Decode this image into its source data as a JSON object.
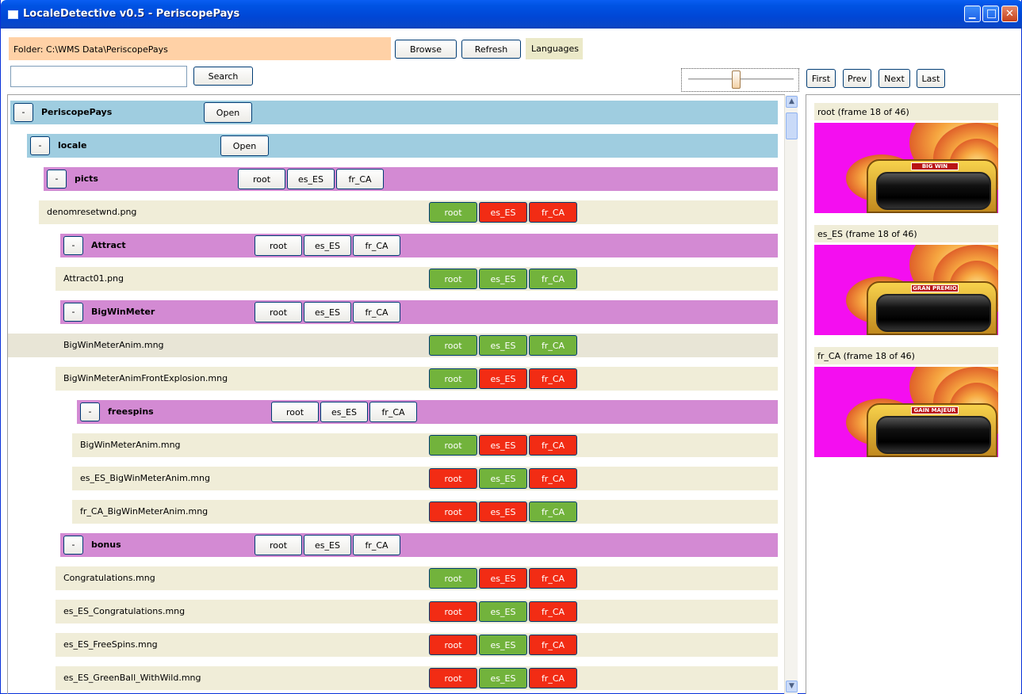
{
  "window": {
    "title": "LocaleDetective v0.5 - PeriscopePays",
    "min_glyph": "▁",
    "max_glyph": "□",
    "close_glyph": "✕"
  },
  "toolbar": {
    "folder_label": "Folder: C:\\WMS Data\\PeriscopePays",
    "browse": "Browse",
    "refresh": "Refresh",
    "languages": "Languages",
    "search_value": "",
    "search_button": "Search",
    "nav": {
      "first": "First",
      "prev": "Prev",
      "next": "Next",
      "last": "Last"
    }
  },
  "tree": {
    "open_label": "Open",
    "toggle_label": "-",
    "rows": [
      {
        "type": "folder",
        "color": "blue",
        "indent": 0,
        "label": "PeriscopePays",
        "action": "open"
      },
      {
        "type": "folder",
        "color": "blue",
        "indent": 1,
        "label": "locale",
        "action": "open"
      },
      {
        "type": "folder",
        "color": "purple",
        "indent": 2,
        "label": "picts",
        "langs": [
          "root",
          "es_ES",
          "fr_CA"
        ]
      },
      {
        "type": "file",
        "indent": 2,
        "label": "denomresetwnd.png",
        "status": {
          "root": "green",
          "es_ES": "red",
          "fr_CA": "red"
        }
      },
      {
        "type": "folder",
        "color": "purple",
        "indent": 3,
        "label": "Attract",
        "langs": [
          "root",
          "es_ES",
          "fr_CA"
        ]
      },
      {
        "type": "file",
        "indent": 3,
        "label": "Attract01.png",
        "status": {
          "root": "green",
          "es_ES": "green",
          "fr_CA": "green"
        }
      },
      {
        "type": "folder",
        "color": "purple",
        "indent": 3,
        "label": "BigWinMeter",
        "langs": [
          "root",
          "es_ES",
          "fr_CA"
        ]
      },
      {
        "type": "file",
        "indent": 3,
        "label": "BigWinMeterAnim.mng",
        "selected": true,
        "status": {
          "root": "green",
          "es_ES": "green",
          "fr_CA": "green"
        }
      },
      {
        "type": "file",
        "indent": 3,
        "label": "BigWinMeterAnimFrontExplosion.mng",
        "status": {
          "root": "green",
          "es_ES": "red",
          "fr_CA": "red"
        }
      },
      {
        "type": "folder",
        "color": "purple",
        "indent": 4,
        "label": "freespins",
        "langs": [
          "root",
          "es_ES",
          "fr_CA"
        ]
      },
      {
        "type": "file",
        "indent": 4,
        "label": "BigWinMeterAnim.mng",
        "status": {
          "root": "green",
          "es_ES": "red",
          "fr_CA": "red"
        }
      },
      {
        "type": "file",
        "indent": 4,
        "label": "es_ES_BigWinMeterAnim.mng",
        "status": {
          "root": "red",
          "es_ES": "green",
          "fr_CA": "red"
        }
      },
      {
        "type": "file",
        "indent": 4,
        "label": "fr_CA_BigWinMeterAnim.mng",
        "status": {
          "root": "red",
          "es_ES": "red",
          "fr_CA": "green"
        }
      },
      {
        "type": "folder",
        "color": "purple",
        "indent": 3,
        "label": "bonus",
        "langs": [
          "root",
          "es_ES",
          "fr_CA"
        ]
      },
      {
        "type": "file",
        "indent": 3,
        "label": "Congratulations.mng",
        "status": {
          "root": "green",
          "es_ES": "red",
          "fr_CA": "red"
        }
      },
      {
        "type": "file",
        "indent": 3,
        "label": "es_ES_Congratulations.mng",
        "status": {
          "root": "red",
          "es_ES": "green",
          "fr_CA": "red"
        }
      },
      {
        "type": "file",
        "indent": 3,
        "label": "es_ES_FreeSpins.mng",
        "status": {
          "root": "red",
          "es_ES": "green",
          "fr_CA": "red"
        }
      },
      {
        "type": "file",
        "indent": 3,
        "label": "es_ES_GreenBall_WithWild.mng",
        "status": {
          "root": "red",
          "es_ES": "green",
          "fr_CA": "red"
        }
      }
    ]
  },
  "slider": {
    "value_fraction": 0.45
  },
  "previews": [
    {
      "caption": "root (frame 18 of 46)",
      "banner": "BIG WIN"
    },
    {
      "caption": "es_ES (frame 18 of 46)",
      "banner": "GRAN PREMIO"
    },
    {
      "caption": "fr_CA (frame 18 of 46)",
      "banner": "GAIN MAJEUR"
    }
  ],
  "colors": {
    "green": "#72b33c",
    "red": "#f22c14",
    "folder_blue": "#9fcde0",
    "folder_purple": "#d38ad3",
    "file_bg": "#f0edd8",
    "folder_bar": "#ffd1a6",
    "preview_bg": "#f40ef0"
  }
}
